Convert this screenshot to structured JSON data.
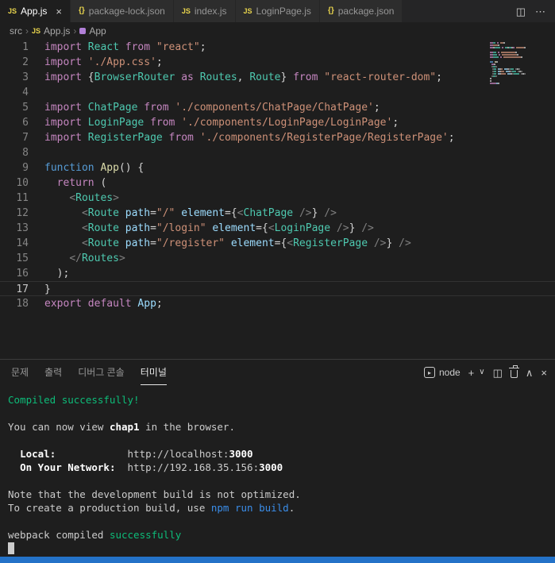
{
  "palette": {
    "kw": "#C586C0",
    "decl": "#569CD6",
    "type": "#4EC9B0",
    "func": "#DCDCAA",
    "attr": "#9CDCFE",
    "str": "#CE9178",
    "plain": "#D4D4D4",
    "tag": "#808080",
    "term_plain": "#CCCCCC",
    "term_bold": "#FFFFFF",
    "term_green": "#0DBC79",
    "term_blue": "#3B8EEA",
    "accent_status": "#2472C8",
    "file_icon_yellow": "#E8D44D",
    "symbol_purple": "#B180D7"
  },
  "icons": {
    "split_editor": "◫",
    "more": "⋯",
    "plus": "+",
    "chevron_down": "∨",
    "chevron_up": "∧",
    "close": "×",
    "run": "▸",
    "breadcrumb_separator": "›",
    "js_badge": "JS",
    "json_badge": "{}"
  },
  "tab_bar": {
    "tabs": [
      {
        "label": "App.js",
        "icon": "js",
        "active": true
      },
      {
        "label": "package-lock.json",
        "icon": "json",
        "active": false
      },
      {
        "label": "index.js",
        "icon": "js",
        "active": false
      },
      {
        "label": "LoginPage.js",
        "icon": "js",
        "active": false
      },
      {
        "label": "package.json",
        "icon": "json",
        "active": false
      }
    ]
  },
  "breadcrumb": {
    "items": [
      {
        "label": "src",
        "icon": "none"
      },
      {
        "label": "App.js",
        "icon": "js"
      },
      {
        "label": "App",
        "icon": "symbol"
      }
    ]
  },
  "editor": {
    "current_line": 17,
    "lines": [
      {
        "n": 1,
        "t": [
          [
            "kw",
            "import "
          ],
          [
            "type",
            "React"
          ],
          [
            "plain",
            " "
          ],
          [
            "kw",
            "from"
          ],
          [
            "plain",
            " "
          ],
          [
            "str",
            "\"react\""
          ],
          [
            "plain",
            ";"
          ]
        ]
      },
      {
        "n": 2,
        "t": [
          [
            "kw",
            "import "
          ],
          [
            "str",
            "'./App.css'"
          ],
          [
            "plain",
            ";"
          ]
        ]
      },
      {
        "n": 3,
        "t": [
          [
            "kw",
            "import "
          ],
          [
            "plain",
            "{"
          ],
          [
            "type",
            "BrowserRouter"
          ],
          [
            "plain",
            " "
          ],
          [
            "kw",
            "as"
          ],
          [
            "plain",
            " "
          ],
          [
            "type",
            "Routes"
          ],
          [
            "plain",
            ", "
          ],
          [
            "type",
            "Route"
          ],
          [
            "plain",
            "} "
          ],
          [
            "kw",
            "from"
          ],
          [
            "plain",
            " "
          ],
          [
            "str",
            "\"react-router-dom\""
          ],
          [
            "plain",
            ";"
          ]
        ]
      },
      {
        "n": 4,
        "t": []
      },
      {
        "n": 5,
        "t": [
          [
            "kw",
            "import "
          ],
          [
            "type",
            "ChatPage"
          ],
          [
            "plain",
            " "
          ],
          [
            "kw",
            "from"
          ],
          [
            "plain",
            " "
          ],
          [
            "str",
            "'./components/ChatPage/ChatPage'"
          ],
          [
            "plain",
            ";"
          ]
        ]
      },
      {
        "n": 6,
        "t": [
          [
            "kw",
            "import "
          ],
          [
            "type",
            "LoginPage"
          ],
          [
            "plain",
            " "
          ],
          [
            "kw",
            "from"
          ],
          [
            "plain",
            " "
          ],
          [
            "str",
            "'./components/LoginPage/LoginPage'"
          ],
          [
            "plain",
            ";"
          ]
        ]
      },
      {
        "n": 7,
        "t": [
          [
            "kw",
            "import "
          ],
          [
            "type",
            "RegisterPage"
          ],
          [
            "plain",
            " "
          ],
          [
            "kw",
            "from"
          ],
          [
            "plain",
            " "
          ],
          [
            "str",
            "'./components/RegisterPage/RegisterPage'"
          ],
          [
            "plain",
            ";"
          ]
        ]
      },
      {
        "n": 8,
        "t": []
      },
      {
        "n": 9,
        "t": [
          [
            "decl",
            "function"
          ],
          [
            "plain",
            " "
          ],
          [
            "func",
            "App"
          ],
          [
            "plain",
            "() {"
          ]
        ]
      },
      {
        "n": 10,
        "t": [
          [
            "plain",
            "  "
          ],
          [
            "kw",
            "return"
          ],
          [
            "plain",
            " ("
          ]
        ]
      },
      {
        "n": 11,
        "t": [
          [
            "plain",
            "    "
          ],
          [
            "tag",
            "<"
          ],
          [
            "type",
            "Routes"
          ],
          [
            "tag",
            ">"
          ]
        ]
      },
      {
        "n": 12,
        "t": [
          [
            "plain",
            "      "
          ],
          [
            "tag",
            "<"
          ],
          [
            "type",
            "Route"
          ],
          [
            "plain",
            " "
          ],
          [
            "attr",
            "path"
          ],
          [
            "plain",
            "="
          ],
          [
            "str",
            "\"/\""
          ],
          [
            "plain",
            " "
          ],
          [
            "attr",
            "element"
          ],
          [
            "plain",
            "={"
          ],
          [
            "tag",
            "<"
          ],
          [
            "type",
            "ChatPage"
          ],
          [
            "plain",
            " "
          ],
          [
            "tag",
            "/>"
          ],
          [
            "plain",
            "} "
          ],
          [
            "tag",
            "/>"
          ]
        ]
      },
      {
        "n": 13,
        "t": [
          [
            "plain",
            "      "
          ],
          [
            "tag",
            "<"
          ],
          [
            "type",
            "Route"
          ],
          [
            "plain",
            " "
          ],
          [
            "attr",
            "path"
          ],
          [
            "plain",
            "="
          ],
          [
            "str",
            "\"/login\""
          ],
          [
            "plain",
            " "
          ],
          [
            "attr",
            "element"
          ],
          [
            "plain",
            "={"
          ],
          [
            "tag",
            "<"
          ],
          [
            "type",
            "LoginPage"
          ],
          [
            "plain",
            " "
          ],
          [
            "tag",
            "/>"
          ],
          [
            "plain",
            "} "
          ],
          [
            "tag",
            "/>"
          ]
        ]
      },
      {
        "n": 14,
        "t": [
          [
            "plain",
            "      "
          ],
          [
            "tag",
            "<"
          ],
          [
            "type",
            "Route"
          ],
          [
            "plain",
            " "
          ],
          [
            "attr",
            "path"
          ],
          [
            "plain",
            "="
          ],
          [
            "str",
            "\"/register\""
          ],
          [
            "plain",
            " "
          ],
          [
            "attr",
            "element"
          ],
          [
            "plain",
            "={"
          ],
          [
            "tag",
            "<"
          ],
          [
            "type",
            "RegisterPage"
          ],
          [
            "plain",
            " "
          ],
          [
            "tag",
            "/>"
          ],
          [
            "plain",
            "} "
          ],
          [
            "tag",
            "/>"
          ]
        ]
      },
      {
        "n": 15,
        "t": [
          [
            "plain",
            "    "
          ],
          [
            "tag",
            "</"
          ],
          [
            "type",
            "Routes"
          ],
          [
            "tag",
            ">"
          ]
        ]
      },
      {
        "n": 16,
        "t": [
          [
            "plain",
            "  );"
          ]
        ]
      },
      {
        "n": 17,
        "t": [
          [
            "plain",
            "}"
          ]
        ]
      },
      {
        "n": 18,
        "t": [
          [
            "kw",
            "export "
          ],
          [
            "kw",
            "default "
          ],
          [
            "attr",
            "App"
          ],
          [
            "plain",
            ";"
          ]
        ]
      }
    ]
  },
  "panel": {
    "tabs": [
      {
        "label": "문제",
        "active": false
      },
      {
        "label": "출력",
        "active": false
      },
      {
        "label": "디버그 콘솔",
        "active": false
      },
      {
        "label": "터미널",
        "active": true
      }
    ],
    "toolbar": {
      "shell_label": "node"
    }
  },
  "terminal": {
    "lines": [
      [
        [
          "g",
          "Compiled successfully!"
        ]
      ],
      [],
      [
        [
          "w",
          "You can now view "
        ],
        [
          "bold",
          "chap1"
        ],
        [
          "w",
          " in the browser."
        ]
      ],
      [],
      [
        [
          "w",
          "  "
        ],
        [
          "bold",
          "Local:"
        ],
        [
          "w",
          "            http://localhost:"
        ],
        [
          "bold",
          "3000"
        ]
      ],
      [
        [
          "w",
          "  "
        ],
        [
          "bold",
          "On Your Network:"
        ],
        [
          "w",
          "  http://192.168.35.156:"
        ],
        [
          "bold",
          "3000"
        ]
      ],
      [],
      [
        [
          "w",
          "Note that the development build is not optimized."
        ]
      ],
      [
        [
          "w",
          "To create a production build, use "
        ],
        [
          "b",
          "npm run build"
        ],
        [
          "w",
          "."
        ]
      ],
      [],
      [
        [
          "w",
          "webpack compiled "
        ],
        [
          "g",
          "successfully"
        ]
      ],
      [
        [
          "cursor",
          ""
        ]
      ]
    ]
  }
}
